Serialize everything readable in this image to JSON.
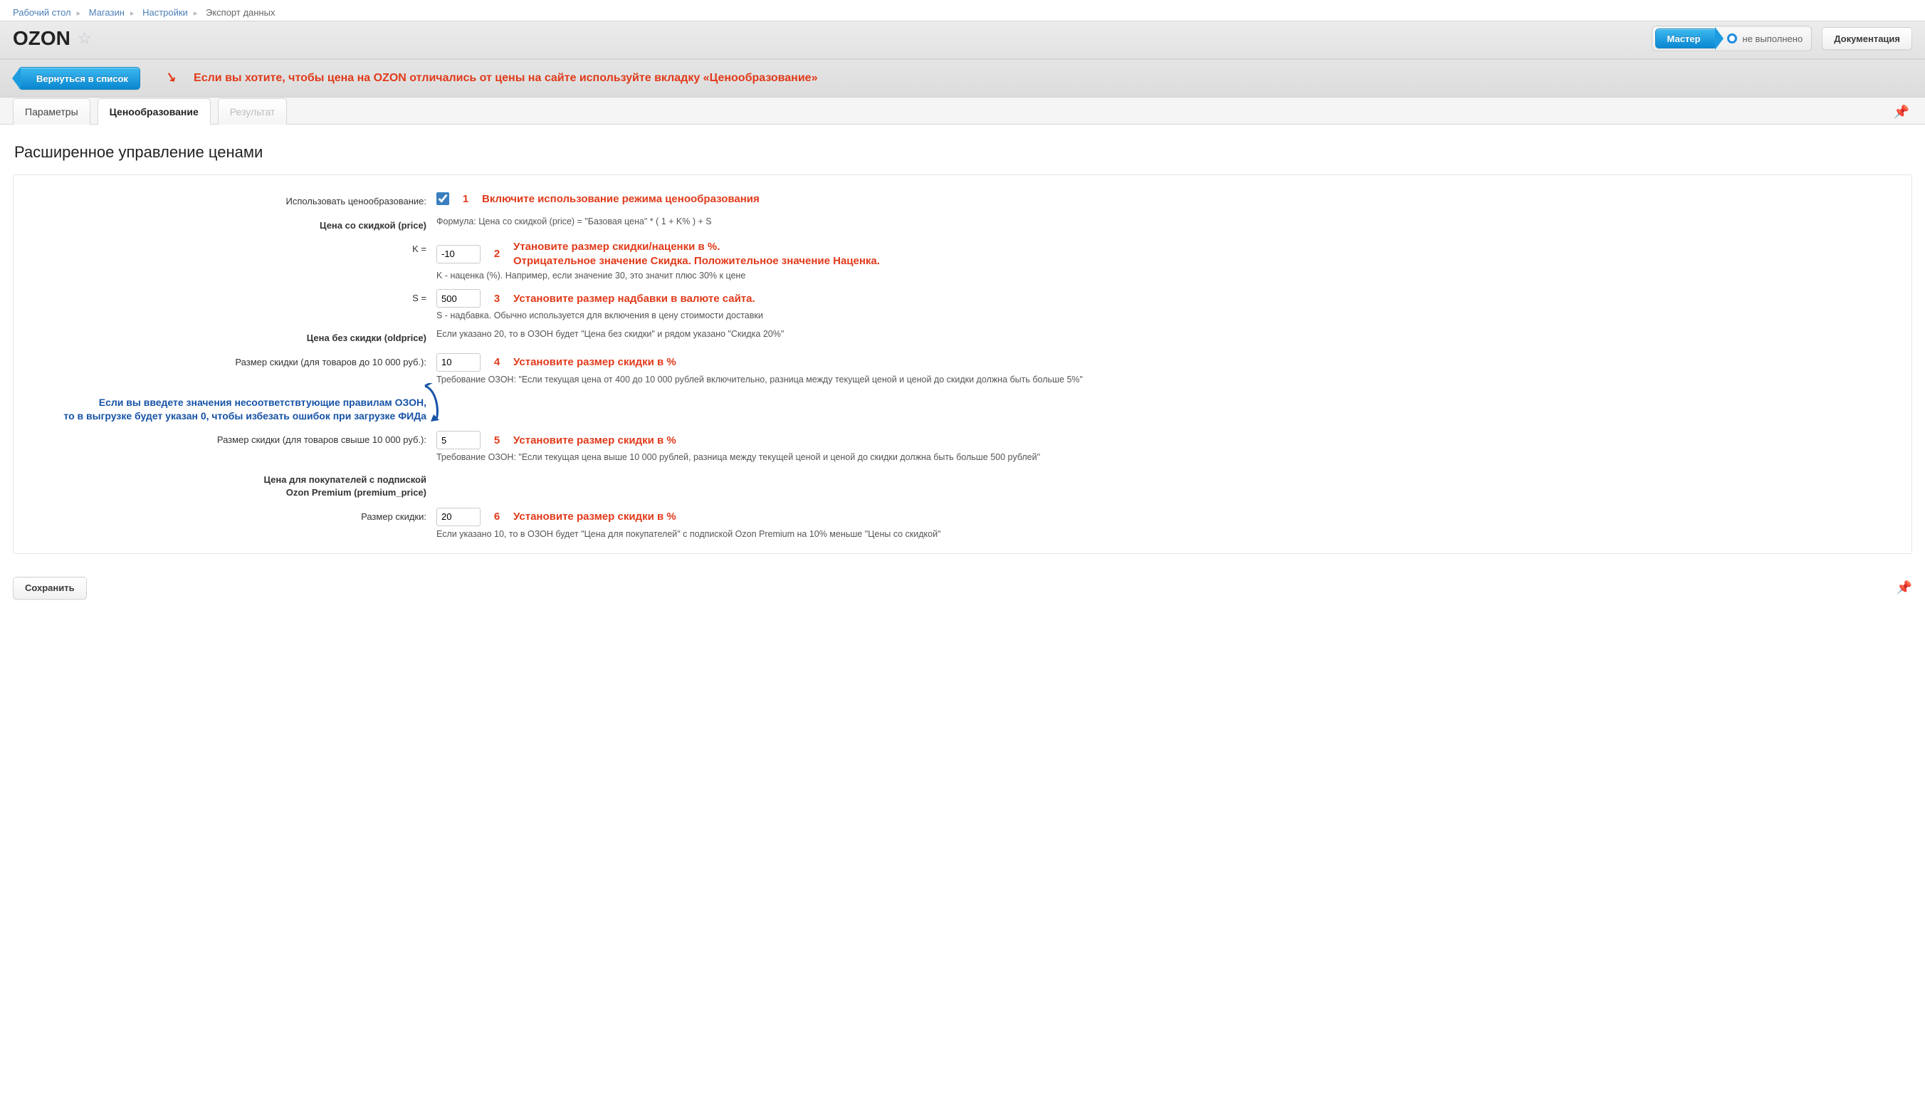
{
  "crumbs": [
    "Рабочий стол",
    "Магазин",
    "Настройки",
    "Экспорт данных"
  ],
  "title": "OZON",
  "header": {
    "master": "Мастер",
    "status": "не выполнено",
    "docs": "Документация"
  },
  "back_btn": "Вернуться в список",
  "banner": "Если вы хотите, чтобы цена на OZON отличались от цены на сайте используйте вкладку «Ценообразование»",
  "tabs": {
    "params": "Параметры",
    "pricing": "Ценообразование",
    "result": "Результат"
  },
  "section_title": "Расширенное управление ценами",
  "use_pricing_label": "Использовать ценообразование:",
  "price_label": "Цена со скидкой (price)",
  "formula": "Формула: Цена со скидкой (price) = \"Базовая цена\" * ( 1 + K% ) + S",
  "k_label": "K =",
  "k_value": "-10",
  "k_hint": "K - наценка (%). Например, если значение 30, это значит плюс 30% к цене",
  "s_label": "S =",
  "s_value": "500",
  "s_hint": "S - надбавка. Обычно используется для включения в цену стоимости доставки",
  "old_label": "Цена без скидки (oldprice)",
  "old_hint": "Если указано 20, то в ОЗОН будет \"Цена без скидки\" и рядом указано \"Скидка 20%\"",
  "disc_low_label": "Размер скидки (для товаров до 10 000 руб.):",
  "disc_low_val": "10",
  "disc_low_req": "Требование ОЗОН: \"Если текущая цена от 400 до 10 000 рублей включительно, разница между текущей ценой и ценой до скидки должна быть больше 5%\"",
  "blue_hint_1": "Если вы введете значения несоответствтующие правилам ОЗОН,",
  "blue_hint_2": "то в выгрузке будет указан 0, чтобы избезать ошибок при загрузке ФИДа",
  "disc_high_label": "Размер скидки (для товаров свыше 10 000 руб.):",
  "disc_high_val": "5",
  "disc_high_req": "Требование ОЗОН: \"Если текущая цена выше 10 000 рублей, разница между текущей ценой и ценой до скидки должна быть больше 500 рублей\"",
  "premium_label_1": "Цена для покупателей с подпиской",
  "premium_label_2": "Ozon Premium (premium_price)",
  "premium_disc_label": "Размер скидки:",
  "premium_disc_val": "20",
  "premium_hint": "Если указано 10, то в ОЗОН будет \"Цена для покупателей\" с подпиской Ozon Premium на 10% меньше \"Цены со скидкой\"",
  "ann": {
    "n1": "1",
    "t1": "Включите использование режима ценообразования",
    "n2": "2",
    "t2a": "Утановите размер скидки/наценки в %.",
    "t2b": "Отрицательное значение Скидка. Положительное значение Наценка.",
    "n3": "3",
    "t3": "Установите размер надбавки в валюте сайта.",
    "n4": "4",
    "t4": "Установите размер скидки в %",
    "n5": "5",
    "t5": "Установите размер скидки в %",
    "n6": "6",
    "t6": "Установите размер скидки в %"
  },
  "save": "Сохранить"
}
